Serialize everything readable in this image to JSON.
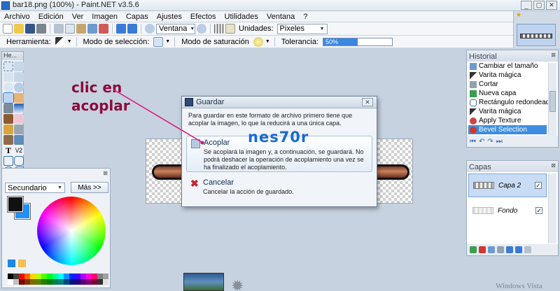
{
  "window": {
    "title": "bar18.png (100%) - Paint.NET v3.5.6",
    "buttons": [
      "_",
      "▢",
      "✕"
    ]
  },
  "menu": [
    "Archivo",
    "Edición",
    "Ver",
    "Imagen",
    "Capas",
    "Ajustes",
    "Efectos",
    "Utilidades",
    "Ventana",
    "?"
  ],
  "toolbar": {
    "zoom_select": "Ventana",
    "units_label": "Unidades:",
    "units_value": "Pixeles"
  },
  "toolbar2": {
    "tool_label": "Herramienta:",
    "selection_mode_label": "Modo de selección:",
    "saturation_mode_label": "Modo de saturación",
    "tolerance_label": "Tolerancia:",
    "tolerance_value": "50%",
    "tolerance_fraction": 0.5
  },
  "tools_panel": {
    "header": "He..."
  },
  "colors_panel": {
    "mode_select": "Secundario",
    "more_button": "Más >>",
    "primary_color": "#111111",
    "secondary_color": "#1e90ff"
  },
  "history": {
    "title": "Historial",
    "items": [
      {
        "label": "Cambiar el tamaño",
        "icon": "resize-icon"
      },
      {
        "label": "Varita mágica",
        "icon": "magic-wand-icon"
      },
      {
        "label": "Cortar",
        "icon": "scissors-icon"
      },
      {
        "label": "Nueva capa",
        "icon": "new-layer-icon"
      },
      {
        "label": "Rectángulo redondeado",
        "icon": "rounded-rect-icon"
      },
      {
        "label": "Varita mágica",
        "icon": "magic-wand-icon"
      },
      {
        "label": "Apply Texture",
        "icon": "texture-icon"
      },
      {
        "label": "Bevel Selection",
        "icon": "bevel-icon"
      }
    ],
    "selected_index": 7
  },
  "layers": {
    "title": "Capas",
    "items": [
      {
        "name": "Capa 2",
        "visible": true,
        "selected": true
      },
      {
        "name": "Fondo",
        "visible": true,
        "selected": false
      }
    ]
  },
  "dialog": {
    "title": "Guardar",
    "message": "Para guardar en este formato de archivo primero tiene que acoplar la imagen, lo que la reducirá a una única capa.",
    "options": [
      {
        "title": "Acoplar",
        "description": "Se acoplará la imagen y, a continuación, se guardará. No podrá deshacer la operación de acoplamiento una vez se ha finalizado el acoplamiento."
      },
      {
        "title": "Cancelar",
        "description": "Cancelar la acción de guardado."
      }
    ]
  },
  "watermark": "nes70r",
  "annotation": {
    "line1": "clic en",
    "line2": "acoplar",
    "color": "#e0117a"
  },
  "taskbar": {
    "brand": "Windows Vista"
  }
}
